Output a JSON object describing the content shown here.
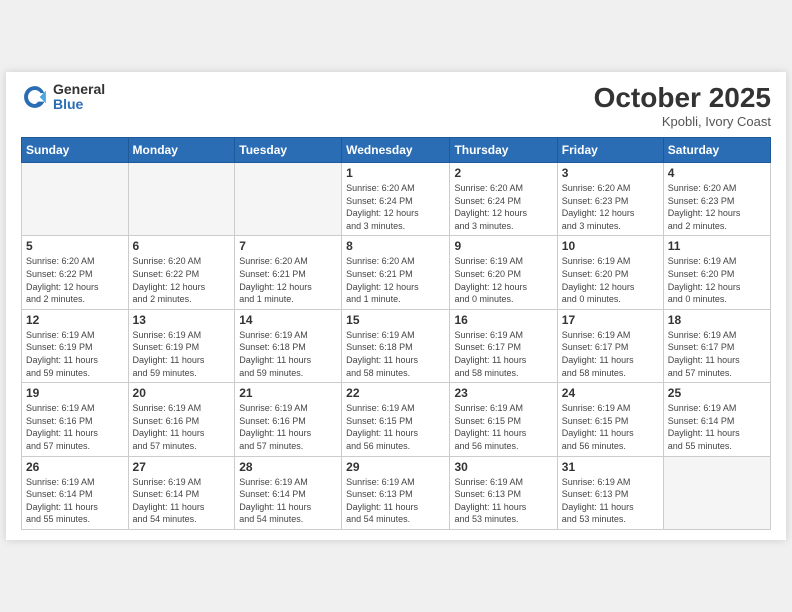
{
  "header": {
    "logo_general": "General",
    "logo_blue": "Blue",
    "month": "October 2025",
    "location": "Kpobli, Ivory Coast"
  },
  "weekdays": [
    "Sunday",
    "Monday",
    "Tuesday",
    "Wednesday",
    "Thursday",
    "Friday",
    "Saturday"
  ],
  "weeks": [
    [
      {
        "day": "",
        "info": ""
      },
      {
        "day": "",
        "info": ""
      },
      {
        "day": "",
        "info": ""
      },
      {
        "day": "1",
        "info": "Sunrise: 6:20 AM\nSunset: 6:24 PM\nDaylight: 12 hours\nand 3 minutes."
      },
      {
        "day": "2",
        "info": "Sunrise: 6:20 AM\nSunset: 6:24 PM\nDaylight: 12 hours\nand 3 minutes."
      },
      {
        "day": "3",
        "info": "Sunrise: 6:20 AM\nSunset: 6:23 PM\nDaylight: 12 hours\nand 3 minutes."
      },
      {
        "day": "4",
        "info": "Sunrise: 6:20 AM\nSunset: 6:23 PM\nDaylight: 12 hours\nand 2 minutes."
      }
    ],
    [
      {
        "day": "5",
        "info": "Sunrise: 6:20 AM\nSunset: 6:22 PM\nDaylight: 12 hours\nand 2 minutes."
      },
      {
        "day": "6",
        "info": "Sunrise: 6:20 AM\nSunset: 6:22 PM\nDaylight: 12 hours\nand 2 minutes."
      },
      {
        "day": "7",
        "info": "Sunrise: 6:20 AM\nSunset: 6:21 PM\nDaylight: 12 hours\nand 1 minute."
      },
      {
        "day": "8",
        "info": "Sunrise: 6:20 AM\nSunset: 6:21 PM\nDaylight: 12 hours\nand 1 minute."
      },
      {
        "day": "9",
        "info": "Sunrise: 6:19 AM\nSunset: 6:20 PM\nDaylight: 12 hours\nand 0 minutes."
      },
      {
        "day": "10",
        "info": "Sunrise: 6:19 AM\nSunset: 6:20 PM\nDaylight: 12 hours\nand 0 minutes."
      },
      {
        "day": "11",
        "info": "Sunrise: 6:19 AM\nSunset: 6:20 PM\nDaylight: 12 hours\nand 0 minutes."
      }
    ],
    [
      {
        "day": "12",
        "info": "Sunrise: 6:19 AM\nSunset: 6:19 PM\nDaylight: 11 hours\nand 59 minutes."
      },
      {
        "day": "13",
        "info": "Sunrise: 6:19 AM\nSunset: 6:19 PM\nDaylight: 11 hours\nand 59 minutes."
      },
      {
        "day": "14",
        "info": "Sunrise: 6:19 AM\nSunset: 6:18 PM\nDaylight: 11 hours\nand 59 minutes."
      },
      {
        "day": "15",
        "info": "Sunrise: 6:19 AM\nSunset: 6:18 PM\nDaylight: 11 hours\nand 58 minutes."
      },
      {
        "day": "16",
        "info": "Sunrise: 6:19 AM\nSunset: 6:17 PM\nDaylight: 11 hours\nand 58 minutes."
      },
      {
        "day": "17",
        "info": "Sunrise: 6:19 AM\nSunset: 6:17 PM\nDaylight: 11 hours\nand 58 minutes."
      },
      {
        "day": "18",
        "info": "Sunrise: 6:19 AM\nSunset: 6:17 PM\nDaylight: 11 hours\nand 57 minutes."
      }
    ],
    [
      {
        "day": "19",
        "info": "Sunrise: 6:19 AM\nSunset: 6:16 PM\nDaylight: 11 hours\nand 57 minutes."
      },
      {
        "day": "20",
        "info": "Sunrise: 6:19 AM\nSunset: 6:16 PM\nDaylight: 11 hours\nand 57 minutes."
      },
      {
        "day": "21",
        "info": "Sunrise: 6:19 AM\nSunset: 6:16 PM\nDaylight: 11 hours\nand 57 minutes."
      },
      {
        "day": "22",
        "info": "Sunrise: 6:19 AM\nSunset: 6:15 PM\nDaylight: 11 hours\nand 56 minutes."
      },
      {
        "day": "23",
        "info": "Sunrise: 6:19 AM\nSunset: 6:15 PM\nDaylight: 11 hours\nand 56 minutes."
      },
      {
        "day": "24",
        "info": "Sunrise: 6:19 AM\nSunset: 6:15 PM\nDaylight: 11 hours\nand 56 minutes."
      },
      {
        "day": "25",
        "info": "Sunrise: 6:19 AM\nSunset: 6:14 PM\nDaylight: 11 hours\nand 55 minutes."
      }
    ],
    [
      {
        "day": "26",
        "info": "Sunrise: 6:19 AM\nSunset: 6:14 PM\nDaylight: 11 hours\nand 55 minutes."
      },
      {
        "day": "27",
        "info": "Sunrise: 6:19 AM\nSunset: 6:14 PM\nDaylight: 11 hours\nand 54 minutes."
      },
      {
        "day": "28",
        "info": "Sunrise: 6:19 AM\nSunset: 6:14 PM\nDaylight: 11 hours\nand 54 minutes."
      },
      {
        "day": "29",
        "info": "Sunrise: 6:19 AM\nSunset: 6:13 PM\nDaylight: 11 hours\nand 54 minutes."
      },
      {
        "day": "30",
        "info": "Sunrise: 6:19 AM\nSunset: 6:13 PM\nDaylight: 11 hours\nand 53 minutes."
      },
      {
        "day": "31",
        "info": "Sunrise: 6:19 AM\nSunset: 6:13 PM\nDaylight: 11 hours\nand 53 minutes."
      },
      {
        "day": "",
        "info": ""
      }
    ]
  ]
}
